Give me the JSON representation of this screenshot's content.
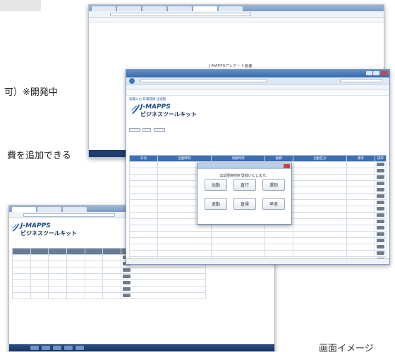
{
  "captions": {
    "line1": "可）※開発中",
    "line2": "費を追加できる",
    "bottom_right": "画面イメージ"
  },
  "window_back": {
    "page_hint": "J-MAPPSアンケート画面"
  },
  "window_front": {
    "brand_line1": "J-MAPPS",
    "brand_line2": "ビジネスツールキット",
    "breadcrumb": "実績入力 日報登録 出退勤",
    "dialog": {
      "message": "出退勤時刻を登録いたします。",
      "buttons": [
        "出勤",
        "直行",
        "遅刻",
        "退勤",
        "直帰",
        "早退"
      ]
    },
    "table_columns": [
      "日付",
      "出勤時刻",
      "退勤時刻",
      "勤務",
      "出勤区分",
      "備考",
      "操作"
    ]
  },
  "window_bottom": {
    "brand_line1": "J-MAPPS",
    "brand_line2": "ビジネスツールキット"
  },
  "icons": {
    "logo": "j-mapps-logo-icon",
    "back": "back-arrow-icon",
    "close": "close-icon"
  },
  "colors": {
    "header_blue": "#3d6fb3",
    "title_blue": "#3a6aa8",
    "taskbar": "#1f3e6e"
  }
}
